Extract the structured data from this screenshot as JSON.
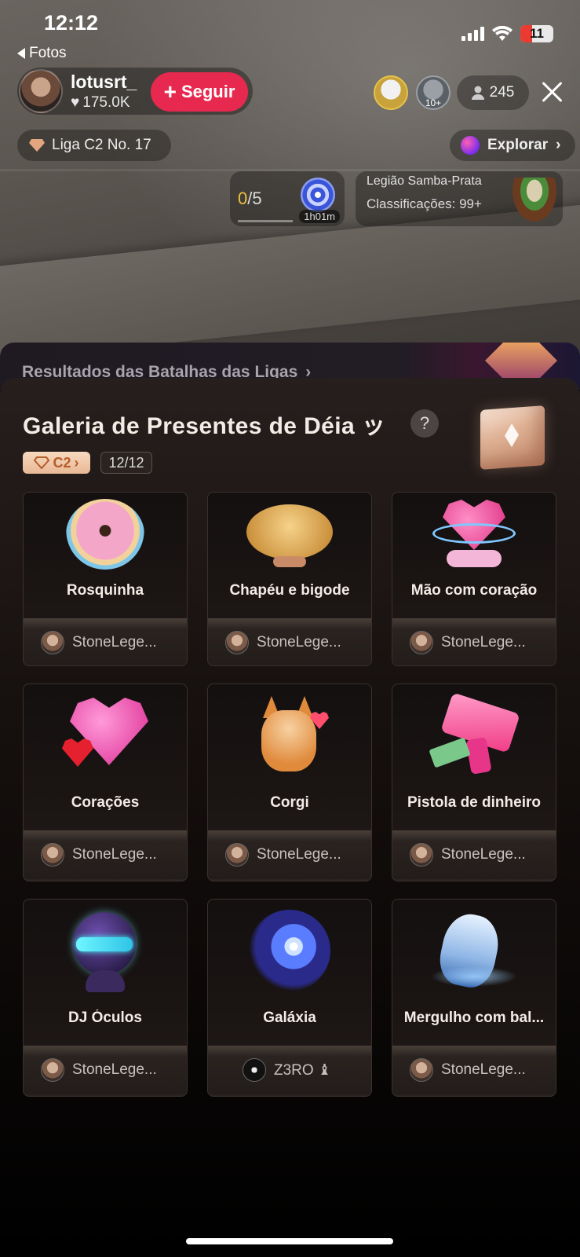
{
  "status_bar": {
    "time": "12:12",
    "battery": "11",
    "back_label": "Fotos"
  },
  "live_header": {
    "host_name": "lotusrt_",
    "host_likes": "175.0K",
    "follow_label": "Seguir",
    "top_viewer_badge": "10+",
    "viewer_count": "245",
    "league_label": "Liga C2 No. 17",
    "explore_label": "Explorar",
    "goal": {
      "current": "0",
      "total": "/5",
      "timer": "1h01m"
    },
    "legion": {
      "title": "Legião Samba-Prata",
      "subtitle": "Classificações: 99+"
    }
  },
  "sheet_behind": {
    "title": "Resultados das Batalhas das Ligas"
  },
  "gallery": {
    "title": "Galeria de Presentes de Déia ッ",
    "help_icon": "?",
    "tier_label": "C2",
    "progress": "12/12",
    "gifts": [
      {
        "name": "Rosquinha",
        "sender": "StoneLege..."
      },
      {
        "name": "Chapéu e bigode",
        "sender": "StoneLege..."
      },
      {
        "name": "Mão com coração",
        "sender": "StoneLege..."
      },
      {
        "name": "Corações",
        "sender": "StoneLege..."
      },
      {
        "name": "Corgi",
        "sender": "StoneLege..."
      },
      {
        "name": "Pistola de dinheiro",
        "sender": "StoneLege..."
      },
      {
        "name": "DJ Óculos",
        "sender": "StoneLege..."
      },
      {
        "name": "Galáxia",
        "sender": "Z3RO ♝"
      },
      {
        "name": "Mergulho com bal...",
        "sender": "StoneLege..."
      }
    ]
  },
  "colors": {
    "follow_button": "#e8294f",
    "goal_current": "#f0c23a",
    "tier_badge_text": "#b55d2b"
  }
}
